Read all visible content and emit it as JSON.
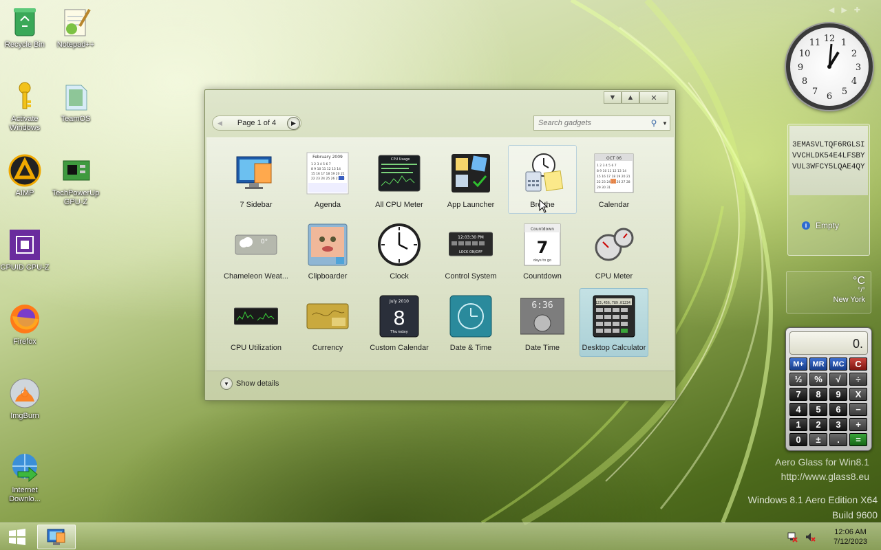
{
  "desktop": {
    "icons": [
      {
        "label": "Recycle Bin",
        "name": "recycle-bin-icon"
      },
      {
        "label": "Notepad++",
        "name": "notepad-plus-plus-icon"
      },
      {
        "label": "Activate Windows",
        "name": "key-icon"
      },
      {
        "label": "TeamOS",
        "name": "teamos-icon"
      },
      {
        "label": "AIMP",
        "name": "aimp-icon"
      },
      {
        "label": "TechPowerUp GPU-Z",
        "name": "gpu-z-icon"
      },
      {
        "label": "CPUID CPU-Z",
        "name": "cpu-z-icon"
      },
      {
        "label": "Firefox",
        "name": "firefox-icon"
      },
      {
        "label": "ImgBurn",
        "name": "imgburn-icon"
      },
      {
        "label": "Internet Downlo...",
        "name": "internet-download-manager-icon"
      }
    ]
  },
  "gallery": {
    "pager_text": "Page 1 of 4",
    "search_placeholder": "Search gadgets",
    "show_details": "Show details",
    "gadgets": [
      {
        "label": "7 Sidebar"
      },
      {
        "label": "Agenda"
      },
      {
        "label": "All CPU Meter"
      },
      {
        "label": "App Launcher"
      },
      {
        "label": "Bre the"
      },
      {
        "label": "Calendar"
      },
      {
        "label": "Chameleon Weat..."
      },
      {
        "label": "Clipboarder"
      },
      {
        "label": "Clock"
      },
      {
        "label": "Control System"
      },
      {
        "label": "Countdown"
      },
      {
        "label": "CPU Meter"
      },
      {
        "label": "CPU Utilization"
      },
      {
        "label": "Currency"
      },
      {
        "label": "Custom Calendar"
      },
      {
        "label": "Date & Time"
      },
      {
        "label": "Date Time"
      },
      {
        "label": "Desktop Calculator"
      }
    ],
    "thumb_text": {
      "agenda_month": "February 2009",
      "calendar_month": "OCT 06",
      "countdown_title": "Countdown",
      "countdown_num": "7",
      "countdown_sub": "days to go",
      "custom_cal_month": "July 2010",
      "custom_cal_day": "8",
      "custom_cal_weekday": "Thursday",
      "datetime_digits": "6:36",
      "control_time": "12:03:30 PM",
      "control_lock": "LOCK ON/OFF",
      "chameleon_temp": "0°",
      "cpu_usage_title": "CPU Usage",
      "calc_display": "123,456,789.01234"
    }
  },
  "sidebar": {
    "note_text": "3EMASVLTQF6RGLSIVVCHLDK54E4LFSBYVUL3WFCY5LQAE4QY",
    "note_status": "Empty",
    "weather_temp": "°C",
    "weather_range": "°/°",
    "weather_city": "New York",
    "calc_display": "0.",
    "calc_keys": [
      "M+",
      "MR",
      "MC",
      "C",
      "½",
      "%",
      "√",
      "÷",
      "7",
      "8",
      "9",
      "X",
      "4",
      "5",
      "6",
      "−",
      "1",
      "2",
      "3",
      "+",
      "0",
      "±",
      ".",
      "="
    ]
  },
  "watermark": {
    "line1": "Aero Glass for Win8.1",
    "line2": "http://www.glass8.eu"
  },
  "edition": {
    "line1": "Windows 8.1 Aero Edition X64",
    "line2": "Build 9600"
  },
  "taskbar": {
    "time": "12:06 AM",
    "date": "7/12/2023"
  },
  "colors": {
    "accent": "#8aa24e",
    "selected": "#a9d3e0"
  }
}
